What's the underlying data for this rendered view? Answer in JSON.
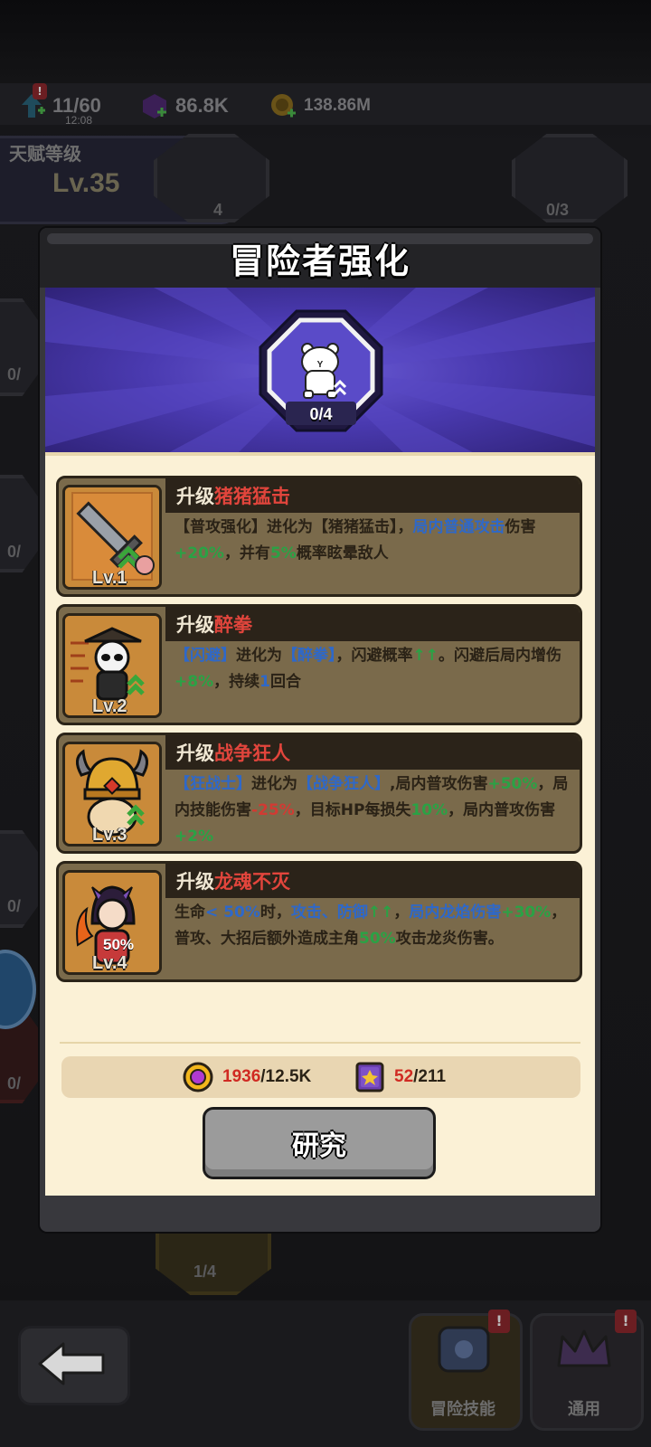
{
  "resources": {
    "stamina": "11/60",
    "stamina_timer": "12:08",
    "gems": "86.8K",
    "gold": "138.86M"
  },
  "talent": {
    "title": "天赋等级",
    "level": "Lv.35",
    "help": "?"
  },
  "background_nodes": [
    "4",
    "0/3",
    "0/",
    "0/",
    "0/",
    "0/",
    "1/4"
  ],
  "modal": {
    "title": "冒险者强化",
    "emblem_progress": "0/4"
  },
  "skills": [
    {
      "title_prefix": "升级",
      "title_name": "猪猪猛击",
      "level": "Lv.1",
      "desc": [
        {
          "t": "【普攻强化】进化为【猪猪猛击】，",
          "c": ""
        },
        {
          "t": "局内普通攻击",
          "c": "b"
        },
        {
          "t": "伤害",
          "c": ""
        },
        {
          "t": "+20%",
          "c": "g"
        },
        {
          "t": "，并有",
          "c": ""
        },
        {
          "t": "5%",
          "c": "g"
        },
        {
          "t": "概率眩晕敌人",
          "c": ""
        }
      ]
    },
    {
      "title_prefix": "升级",
      "title_name": "醉拳",
      "level": "Lv.2",
      "desc": [
        {
          "t": "【闪避】",
          "c": "b"
        },
        {
          "t": "进化为",
          "c": ""
        },
        {
          "t": "【醉拳】",
          "c": "b"
        },
        {
          "t": "，闪避概率",
          "c": ""
        },
        {
          "t": "↑↑",
          "c": "g"
        },
        {
          "t": "。闪避后局内增伤",
          "c": ""
        },
        {
          "t": "+8%",
          "c": "g"
        },
        {
          "t": "，持续",
          "c": ""
        },
        {
          "t": "1",
          "c": "b"
        },
        {
          "t": "回合",
          "c": ""
        }
      ]
    },
    {
      "title_prefix": "升级",
      "title_name": "战争狂人",
      "level": "Lv.3",
      "desc": [
        {
          "t": "【狂战士】",
          "c": "b"
        },
        {
          "t": "进化为",
          "c": ""
        },
        {
          "t": "【战争狂人】",
          "c": "b"
        },
        {
          "t": ",局内普攻伤害",
          "c": ""
        },
        {
          "t": "+50%",
          "c": "g"
        },
        {
          "t": "，局内技能伤害",
          "c": ""
        },
        {
          "t": "-25%",
          "c": "r"
        },
        {
          "t": "，目标HP每损失",
          "c": ""
        },
        {
          "t": "10%",
          "c": "g"
        },
        {
          "t": "，局内普攻伤害",
          "c": ""
        },
        {
          "t": "+2%",
          "c": "g"
        }
      ]
    },
    {
      "title_prefix": "升级",
      "title_name": "龙魂不灭",
      "level": "Lv.4",
      "badge": "50%",
      "desc": [
        {
          "t": "生命",
          "c": ""
        },
        {
          "t": "< 50%",
          "c": "b"
        },
        {
          "t": "时，",
          "c": ""
        },
        {
          "t": "攻击、防御",
          "c": "b"
        },
        {
          "t": "↑↑",
          "c": "g"
        },
        {
          "t": "，",
          "c": ""
        },
        {
          "t": "局内龙焰伤害",
          "c": "b"
        },
        {
          "t": "+30%",
          "c": "g"
        },
        {
          "t": "，普攻、大招后额外造成主角",
          "c": ""
        },
        {
          "t": "50%",
          "c": "g"
        },
        {
          "t": "攻击龙炎伤害。",
          "c": ""
        }
      ]
    }
  ],
  "cost": {
    "coin_current": "1936",
    "coin_required": "/12.5K",
    "book_current": "52",
    "book_required": "/211"
  },
  "research_button": "研究",
  "bottom_nav": {
    "adventure_skill": "冒险技能",
    "general": "通用"
  },
  "colors": {
    "accent_red": "#e2453c",
    "accent_blue": "#2e68c9",
    "accent_green": "#2aa245",
    "card_bg": "#7a6a4b",
    "panel_bg": "#fbf1d6"
  }
}
